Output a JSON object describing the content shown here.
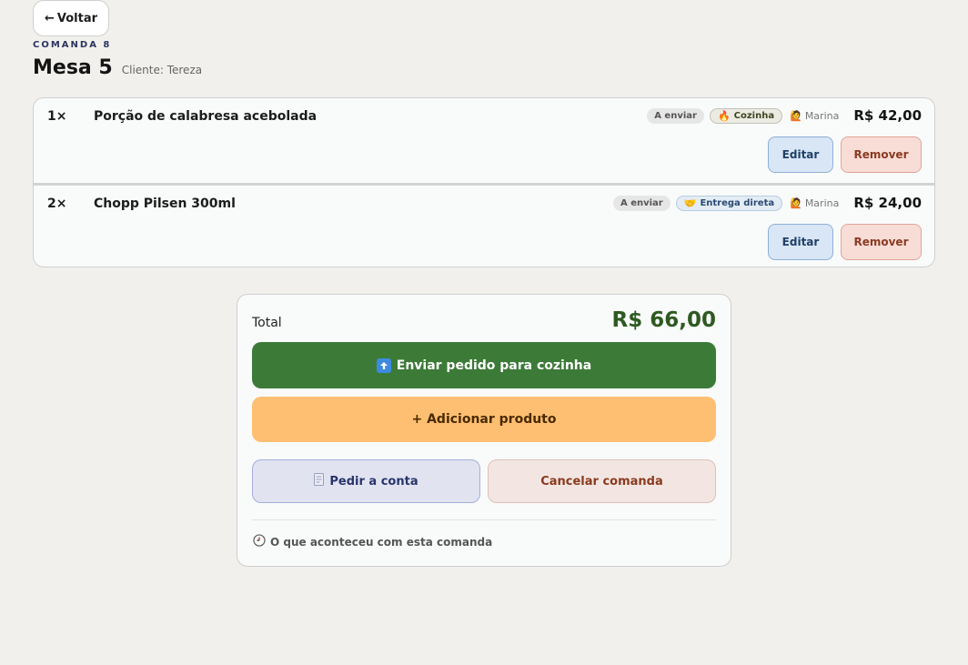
{
  "header": {
    "back_label": "Voltar",
    "comanda_label": "COMANDA 8",
    "title": "Mesa 5",
    "client": "Cliente: Tereza"
  },
  "items": [
    {
      "qty": "1×",
      "name": "Porção de calabresa acebolada",
      "status": "A enviar",
      "destination": "Cozinha",
      "destination_icon": "fire-icon",
      "waiter": "Marina",
      "price": "R$ 42,00",
      "edit_label": "Editar",
      "remove_label": "Remover"
    },
    {
      "qty": "2×",
      "name": "Chopp Pilsen 300ml",
      "status": "A enviar",
      "destination": "Entrega direta",
      "destination_icon": "handshake-icon",
      "waiter": "Marina",
      "price": "R$ 24,00",
      "edit_label": "Editar",
      "remove_label": "Remover"
    }
  ],
  "summary": {
    "total_label": "Total",
    "total_value": "R$ 66,00",
    "send_label": "Enviar pedido para cozinha",
    "add_label": "+ Adicionar produto",
    "bill_label": "Pedir a conta",
    "cancel_label": "Cancelar comanda",
    "history_label": "O que aconteceu com esta comanda"
  },
  "colors": {
    "primary_green": "#3c7a38",
    "add_orange": "#ffbf72",
    "total_green": "#2e5a22",
    "background": "#f2f0ec"
  }
}
